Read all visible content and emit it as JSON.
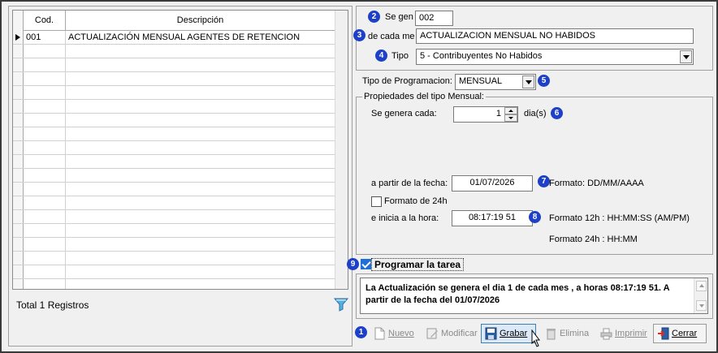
{
  "grid": {
    "columns": [
      "Cod.",
      "Descripción"
    ],
    "rows": [
      {
        "cod": "001",
        "descripcion": "ACTUALIZACIÓN MENSUAL AGENTES DE RETENCION"
      }
    ],
    "total_label": "Total 1 Registros"
  },
  "form": {
    "se_genera_label": "Se gen",
    "se_genera_value": "002",
    "de_cada_label": "de cada me",
    "de_cada_value": "ACTUALIZACION MENSUAL NO HABIDOS",
    "tipo_label": "Tipo",
    "tipo_value": "5 - Contribuyentes No Habidos",
    "tipo_programacion_label": "Tipo de Programacion:",
    "tipo_programacion_value": "MENSUAL",
    "group_title": "Propiedades del tipo Mensual:",
    "se_genera_cada_label": "Se genera cada:",
    "se_genera_cada_value": "1",
    "dias_label": "dia(s)",
    "fecha_label": "a partir de la fecha:",
    "fecha_value": "01/07/2026",
    "fecha_formato": "Formato: DD/MM/AAAA",
    "formato24_label": "Formato de 24h",
    "hora_label": "e inicia a la hora:",
    "hora_value": "08:17:19 51",
    "formato12_hint": "Formato 12h : HH:MM:SS (AM/PM)",
    "formato24_hint": "Formato 24h : HH:MM",
    "programar_label": "Programar la tarea",
    "summary": "La Actualización se genera el dia 1 de cada mes , a horas 08:17:19 51. A partir de la fecha del 01/07/2026"
  },
  "badges": [
    "1",
    "2",
    "3",
    "4",
    "5",
    "6",
    "7",
    "8",
    "9"
  ],
  "toolbar": {
    "nuevo": "Nuevo",
    "modificar": "Modificar",
    "grabar": "Grabar",
    "elimina": "Elimina",
    "imprimir": "Imprimir",
    "cerrar": "Cerrar"
  },
  "colors": {
    "badge": "#1e40c8",
    "checkbox_checked": "#1e6fd6",
    "button_hover": "#dbe9f8"
  }
}
